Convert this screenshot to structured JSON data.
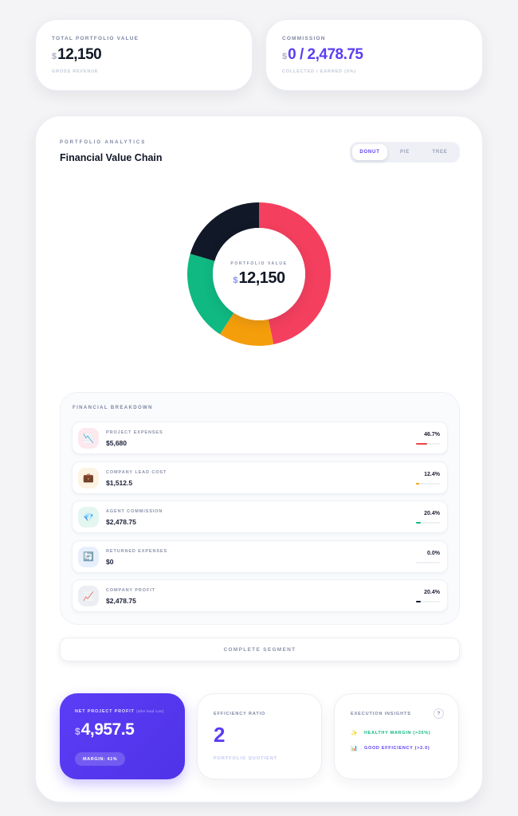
{
  "top_cards": {
    "total": {
      "kicker": "TOTAL PORTFOLIO VALUE",
      "currency": "$",
      "value": "12,150",
      "sub": "GROSS REVENUE"
    },
    "commission": {
      "kicker": "COMMISSION",
      "currency": "$",
      "value": "0 / 2,478.75",
      "sub": "COLLECTED / EARNED (0%)"
    }
  },
  "main": {
    "kicker": "PORTFOLIO ANALYTICS",
    "title": "Financial Value Chain",
    "tabs": [
      {
        "label": "DONUT",
        "active": true
      },
      {
        "label": "PIE",
        "active": false
      },
      {
        "label": "TREE",
        "active": false
      }
    ],
    "center": {
      "kicker": "PORTFOLIO VALUE",
      "currency": "$",
      "value": "12,150"
    }
  },
  "chart_data": {
    "type": "pie",
    "categories": [
      "Project Expenses",
      "Company Lead Cost",
      "Agent Commission",
      "Returned Expenses",
      "Company Profit"
    ],
    "values": [
      46.7,
      12.4,
      20.4,
      0.0,
      20.4
    ],
    "colors": [
      "#f43f5e",
      "#f59e0b",
      "#10b981",
      "#3b82f6",
      "#111827"
    ]
  },
  "breakdown": {
    "title": "FINANCIAL BREAKDOWN",
    "rows": [
      {
        "label": "PROJECT EXPENSES",
        "amount": "$5,680",
        "percent": "46.7%",
        "fraction": 0.467,
        "color": "#ef4444",
        "icon": "chart-down-icon",
        "glyph": "📉",
        "icon_bg": "#fde8ee"
      },
      {
        "label": "COMPANY LEAD COST",
        "amount": "$1,512.5",
        "percent": "12.4%",
        "fraction": 0.124,
        "color": "#f59e0b",
        "icon": "briefcase-icon",
        "glyph": "💼",
        "icon_bg": "#fdf3e3"
      },
      {
        "label": "AGENT COMMISSION",
        "amount": "$2,478.75",
        "percent": "20.4%",
        "fraction": 0.204,
        "color": "#10b981",
        "icon": "gem-icon",
        "glyph": "💎",
        "icon_bg": "#e4f6f0"
      },
      {
        "label": "RETURNED EXPENSES",
        "amount": "$0",
        "percent": "0.0%",
        "fraction": 0.0,
        "color": "#3b82f6",
        "icon": "refresh-icon",
        "glyph": "🔄",
        "icon_bg": "#e8effc"
      },
      {
        "label": "COMPANY PROFIT",
        "amount": "$2,478.75",
        "percent": "20.4%",
        "fraction": 0.204,
        "color": "#111827",
        "icon": "chart-up-icon",
        "glyph": "📈",
        "icon_bg": "#eceef3"
      }
    ]
  },
  "complete_button": "COMPLETE SEGMENT",
  "net_profit": {
    "title": "NET PROJECT PROFIT",
    "title_note": "(after lead cost)",
    "currency": "$",
    "value": "4,957.5",
    "margin": "MARGIN: 41%"
  },
  "efficiency": {
    "title": "EFFICIENCY RATIO",
    "value": "2",
    "sub": "PORTFOLIO QUOTIENT"
  },
  "insights": {
    "title": "EXECUTION INSIGHTS",
    "help": "?",
    "items": [
      {
        "icon": "sparkles-icon",
        "glyph": "✨",
        "text": "HEALTHY MARGIN (>35%)",
        "color": "#10b981"
      },
      {
        "icon": "chart-icon",
        "glyph": "📊",
        "text": "GOOD EFFICIENCY (>2.0)",
        "color": "#5b3df5"
      }
    ]
  }
}
